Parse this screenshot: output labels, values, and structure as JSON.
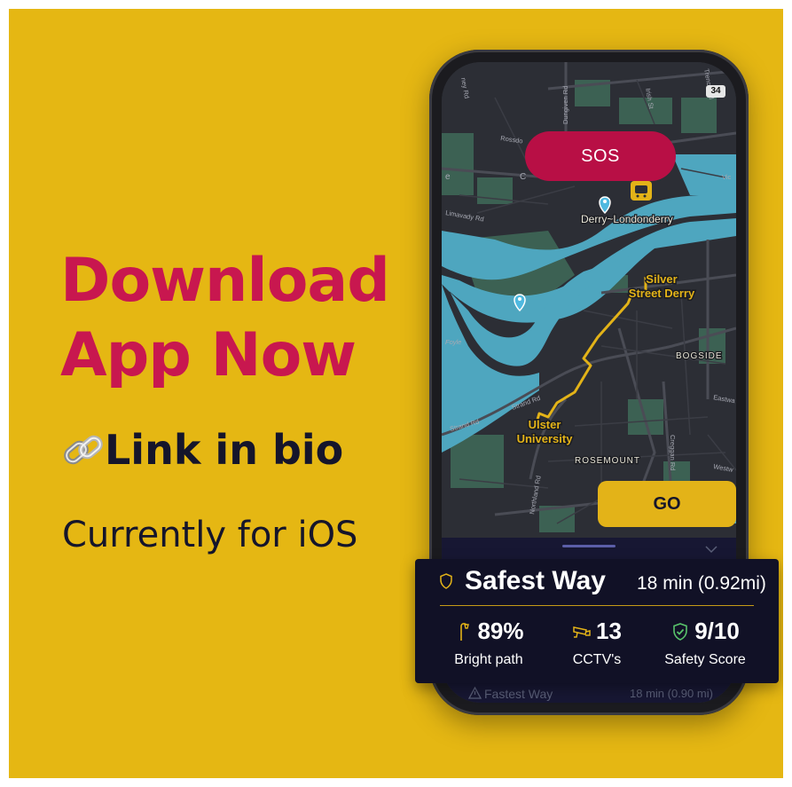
{
  "headline": {
    "line1": "Download",
    "line2": "App Now"
  },
  "link_line": {
    "text": "Link in bio",
    "icon": "link-chain-icon"
  },
  "platform_line": "Currently for iOS",
  "phone": {
    "status_badge": "34",
    "sos_label": "SOS",
    "go_label": "GO",
    "map": {
      "place_labels": {
        "derry": "Derry~Londonderry",
        "silver_line1": "Silver",
        "silver_line2": "Street Derry",
        "ulster_line1": "Ulster",
        "ulster_line2": "University",
        "bogside": "BOGSIDE",
        "rosemount": "ROSEMOUNT",
        "foyle": "Foyle"
      },
      "road_labels": {
        "strand_rd": "Strand Rd",
        "strand_rd_2": "Strand Rd",
        "northland_rd": "Northland Rd",
        "creggan_rd": "Creggan Rd",
        "limavady_rd": "Limavady Rd",
        "dungiven_rd": "Dungiven Rd",
        "rossdowney": "Rossdo",
        "irish_st": "Irish St",
        "trench_rd": "Trench Rd",
        "ney_rd": "ney Rd",
        "vic": "Vic",
        "eastwa": "Eastwa",
        "westw": "Westw",
        "c_label": "C",
        "e_label": "e"
      },
      "colors": {
        "water": "#4ea6bf",
        "land": "#2c2e35",
        "park": "#3c6153",
        "route": "#e3b318"
      }
    },
    "fastest_way": {
      "label": "Fastest Way",
      "time": "18 min (0.90 mi)"
    }
  },
  "route_card": {
    "title": "Safest Way",
    "time": "18 min (0.92mi)",
    "stats": [
      {
        "value": "89%",
        "label": "Bright path",
        "icon": "streetlight-icon"
      },
      {
        "value": "13",
        "label": "CCTV's",
        "icon": "cctv-camera-icon"
      },
      {
        "value": "9/10",
        "label": "Safety Score",
        "icon": "shield-check-icon"
      }
    ]
  },
  "colors": {
    "background": "#e5b713",
    "accent": "#c8174f",
    "dark": "#15152b",
    "sos": "#b80f45",
    "card": "#111126"
  }
}
